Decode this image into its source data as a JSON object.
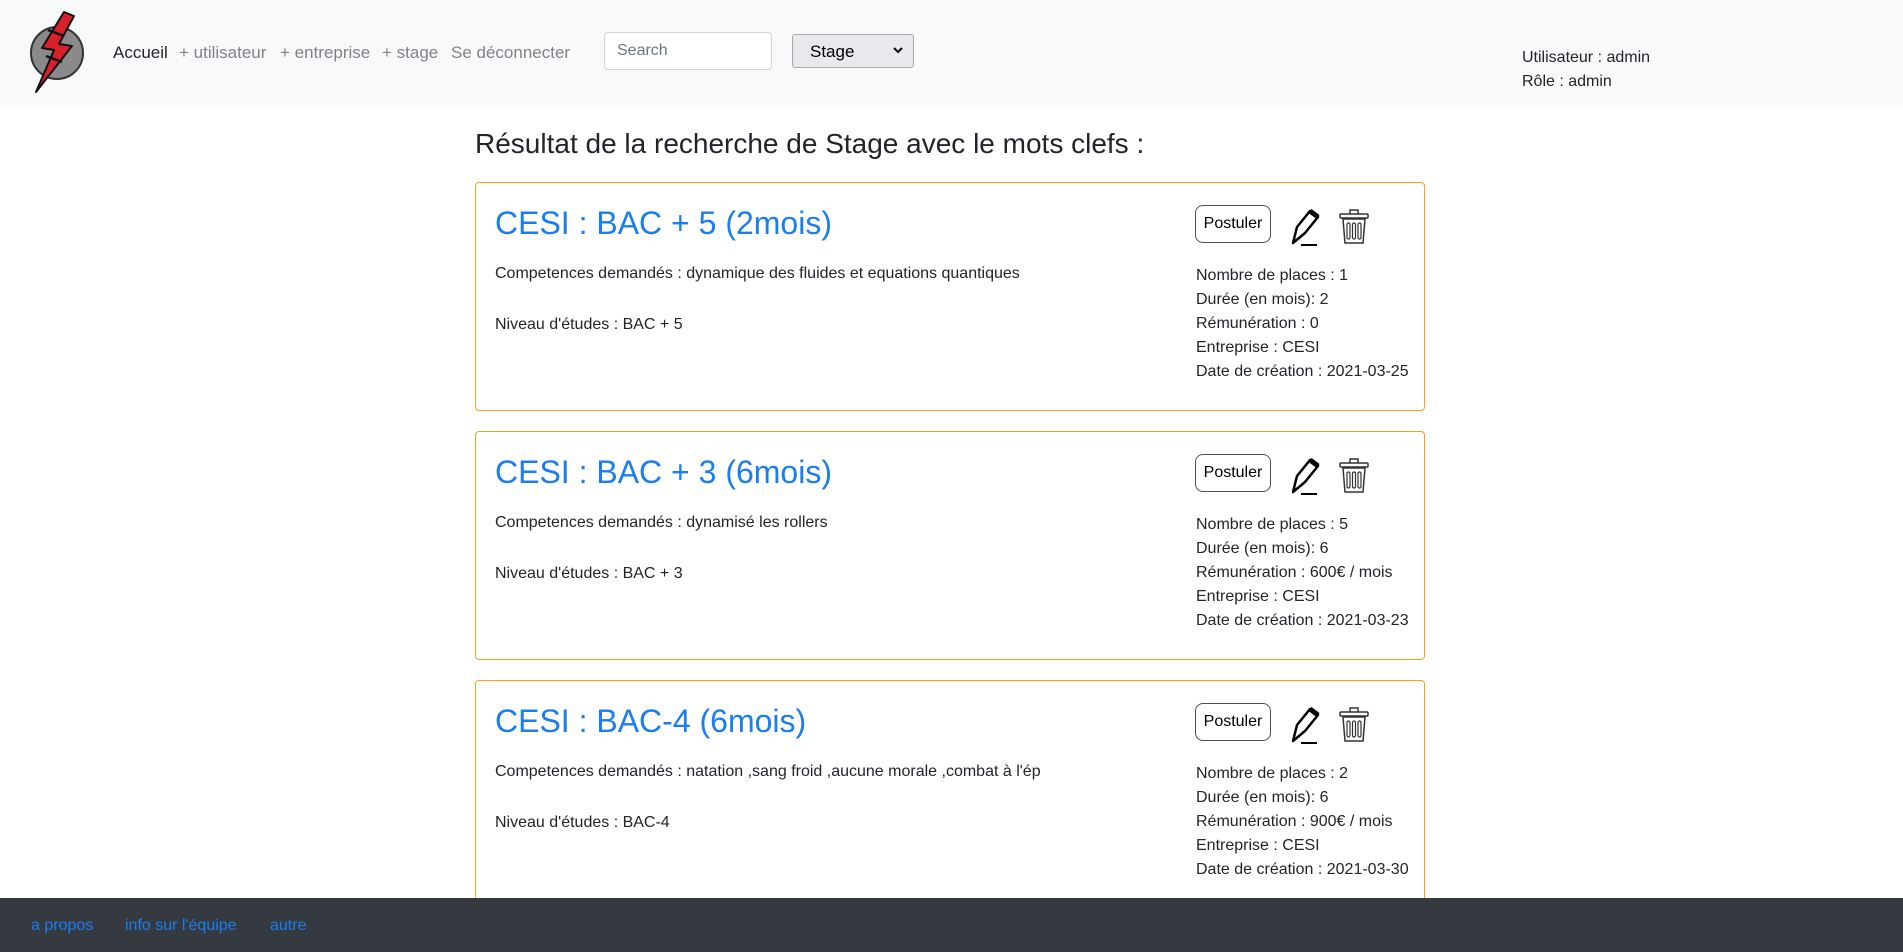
{
  "nav": {
    "links": [
      "Accueil",
      "+ utilisateur",
      "+ entreprise",
      "+ stage",
      "Se déconnecter"
    ],
    "search_placeholder": "Search",
    "select_value": "Stage",
    "user_line": "Utilisateur : admin",
    "role_line": "Rôle : admin"
  },
  "page_title": "Résultat de la recherche de Stage avec le mots clefs :",
  "apply_label": "Postuler",
  "offers": [
    {
      "title": "CESI : BAC + 5 (2mois)",
      "competences": "Competences demandés : dynamique des fluides et equations quantiques",
      "niveau": "Niveau d'études : BAC + 5",
      "places": "Nombre de places : 1",
      "duree": "Durée (en mois): 2",
      "remuneration": "Rémunération : 0",
      "entreprise": "Entreprise : CESI",
      "date": "Date de création : 2021-03-25"
    },
    {
      "title": "CESI : BAC + 3 (6mois)",
      "competences": "Competences demandés : dynamisé les rollers",
      "niveau": "Niveau d'études : BAC + 3",
      "places": "Nombre de places : 5",
      "duree": "Durée (en mois): 6",
      "remuneration": "Rémunération : 600€ / mois",
      "entreprise": "Entreprise : CESI",
      "date": "Date de création : 2021-03-23"
    },
    {
      "title": "CESI : BAC-4 (6mois)",
      "competences": "Competences demandés : natation ,sang froid ,aucune morale ,combat à l'ép",
      "niveau": "Niveau d'études : BAC-4",
      "places": "Nombre de places : 2",
      "duree": "Durée (en mois): 6",
      "remuneration": "Rémunération : 900€ / mois",
      "entreprise": "Entreprise : CESI",
      "date": "Date de création : 2021-03-30"
    }
  ],
  "footer": {
    "links": [
      "a propos",
      "info sur l'équipe",
      "autre"
    ]
  },
  "colors": {
    "accent": "#1a7ef0",
    "card_border": "#ff9f1a",
    "footer_bg": "#343a40",
    "navbar_bg": "#f8f9fa"
  },
  "icons": {
    "logo": "lightning-logo",
    "edit": "pen-icon",
    "delete": "trash-icon",
    "select": "chevron-down-icon"
  }
}
